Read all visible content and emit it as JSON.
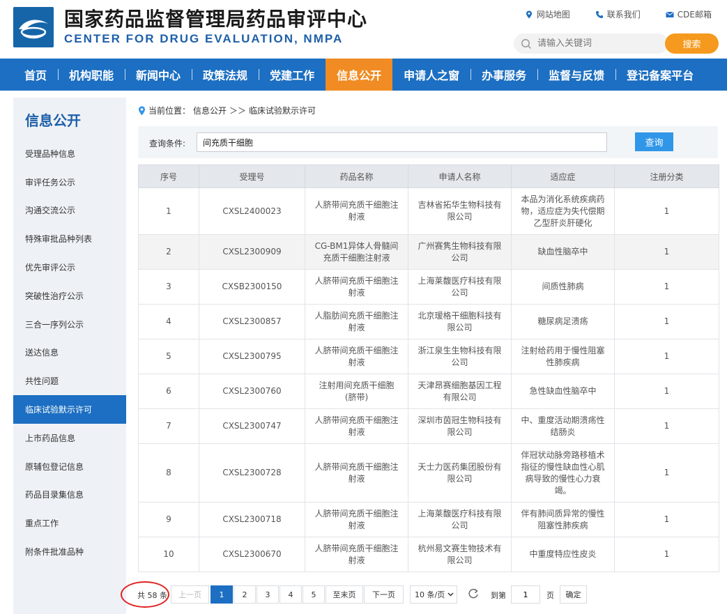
{
  "header": {
    "title_cn": "国家药品监督管理局药品审评中心",
    "title_en": "CENTER FOR DRUG EVALUATION, NMPA",
    "links": [
      {
        "label": "网站地图",
        "icon": "location-pin-icon"
      },
      {
        "label": "联系我们",
        "icon": "phone-icon"
      },
      {
        "label": "CDE邮箱",
        "icon": "mail-icon"
      }
    ],
    "search_placeholder": "请输入关键词",
    "search_button": "搜索"
  },
  "nav": {
    "items": [
      "首页",
      "机构职能",
      "新闻中心",
      "政策法规",
      "党建工作",
      "信息公开",
      "申请人之窗",
      "办事服务",
      "监督与反馈",
      "登记备案平台"
    ],
    "active": "信息公开"
  },
  "sidebar": {
    "title": "信息公开",
    "items": [
      "受理品种信息",
      "审评任务公示",
      "沟通交流公示",
      "特殊审批品种列表",
      "优先审评公示",
      "突破性治疗公示",
      "三合一序列公示",
      "送达信息",
      "共性问题",
      "临床试验默示许可",
      "上市药品信息",
      "原辅包登记信息",
      "药品目录集信息",
      "重点工作",
      "附条件批准品种"
    ],
    "active": "临床试验默示许可"
  },
  "breadcrumb": {
    "prefix": "当前位置：",
    "path1": "信息公开",
    "separator": "＞＞",
    "path2": "临床试验默示许可"
  },
  "query": {
    "label": "查询条件:",
    "value": "间充质干细胞",
    "button": "查询"
  },
  "table": {
    "columns": [
      "序号",
      "受理号",
      "药品名称",
      "申请人名称",
      "适应症",
      "注册分类"
    ],
    "rows": [
      {
        "no": "1",
        "id": "CXSL2400023",
        "drug": "人脐带间充质干细胞注射液",
        "applicant": "吉林省拓华生物科技有限公司",
        "indication": "本品为消化系统疾病药物，适应症为失代偿期乙型肝炎肝硬化",
        "cls": "1"
      },
      {
        "no": "2",
        "id": "CXSL2300909",
        "drug": "CG-BM1异体人骨髓间充质干细胞注射液",
        "applicant": "广州赛隽生物科技有限公司",
        "indication": "缺血性脑卒中",
        "cls": "1"
      },
      {
        "no": "3",
        "id": "CXSB2300150",
        "drug": "人脐带间充质干细胞注射液",
        "applicant": "上海莱馥医疗科技有限公司",
        "indication": "间质性肺病",
        "cls": "1"
      },
      {
        "no": "4",
        "id": "CXSL2300857",
        "drug": "人脂肪间充质干细胞注射液",
        "applicant": "北京瑷格干细胞科技有限公司",
        "indication": "糖尿病足溃疡",
        "cls": "1"
      },
      {
        "no": "5",
        "id": "CXSL2300795",
        "drug": "人脐带间充质干细胞注射液",
        "applicant": "浙江泉生生物科技有限公司",
        "indication": "注射给药用于慢性阻塞性肺疾病",
        "cls": "1"
      },
      {
        "no": "6",
        "id": "CXSL2300760",
        "drug": "注射用间充质干细胞(脐带)",
        "applicant": "天津昂赛细胞基因工程有限公司",
        "indication": "急性缺血性脑卒中",
        "cls": "1"
      },
      {
        "no": "7",
        "id": "CXSL2300747",
        "drug": "人脐带间充质干细胞注射液",
        "applicant": "深圳市茵冠生物科技有限公司",
        "indication": "中、重度活动期溃疡性结肠炎",
        "cls": "1"
      },
      {
        "no": "8",
        "id": "CXSL2300728",
        "drug": "人脐带间充质干细胞注射液",
        "applicant": "天士力医药集团股份有限公司",
        "indication": "伴冠状动脉旁路移植术指征的慢性缺血性心肌病导致的慢性心力衰竭。",
        "cls": "1"
      },
      {
        "no": "9",
        "id": "CXSL2300718",
        "drug": "人脐带间充质干细胞注射液",
        "applicant": "上海莱馥医疗科技有限公司",
        "indication": "伴有肺间质异常的慢性阻塞性肺疾病",
        "cls": "1"
      },
      {
        "no": "10",
        "id": "CXSL2300670",
        "drug": "人脐带间充质干细胞注射液",
        "applicant": "杭州易文赛生物技术有限公司",
        "indication": "中重度特应性皮炎",
        "cls": "1"
      }
    ]
  },
  "pager": {
    "total": "共 58 条",
    "prev": "上一页",
    "pages": [
      "1",
      "2",
      "3",
      "4",
      "5"
    ],
    "current": "1",
    "last": "至末页",
    "next": "下一页",
    "per_page": "10 条/页",
    "goto_prefix": "到第",
    "goto_value": "1",
    "goto_suffix": "页",
    "confirm": "确定"
  },
  "colors": {
    "brand_blue": "#1c6fc2",
    "active_orange": "#f08c23",
    "search_orange": "#f59a1e",
    "query_blue": "#2f96e8",
    "annotation_red": "#e02020"
  }
}
